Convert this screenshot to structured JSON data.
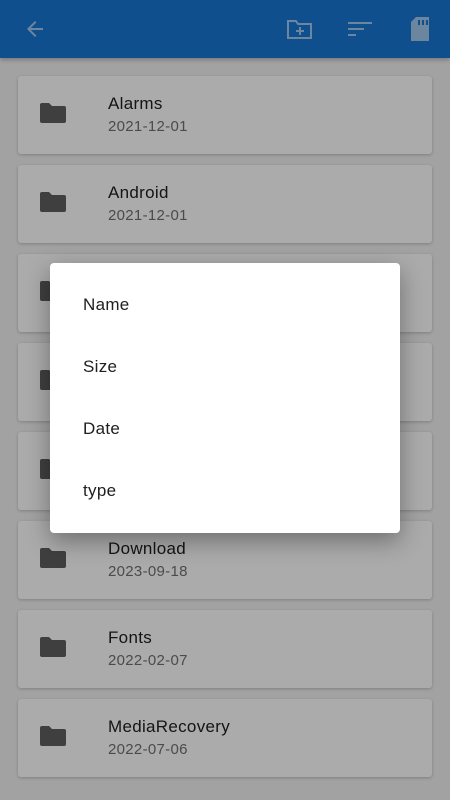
{
  "appbar": {
    "color": "#1976d2",
    "back_icon": "arrow-back-icon",
    "new_folder_icon": "create-new-folder-icon",
    "sort_icon": "sort-icon",
    "sd_card_icon": "sd-card-icon"
  },
  "folders": [
    {
      "name": "Alarms",
      "date": "2021-12-01"
    },
    {
      "name": "Android",
      "date": "2021-12-01"
    },
    {
      "name": "",
      "date": ""
    },
    {
      "name": "",
      "date": ""
    },
    {
      "name": "",
      "date": ""
    },
    {
      "name": "Download",
      "date": "2023-09-18"
    },
    {
      "name": "Fonts",
      "date": "2022-02-07"
    },
    {
      "name": "MediaRecovery",
      "date": "2022-07-06"
    }
  ],
  "sort_dialog": {
    "options": [
      "Name",
      "Size",
      "Date",
      "type"
    ]
  }
}
